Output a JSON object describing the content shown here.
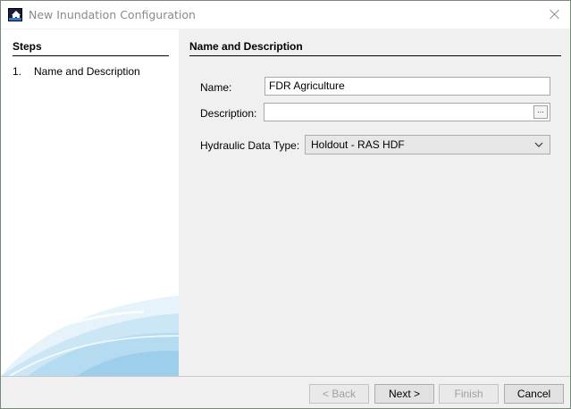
{
  "window": {
    "title": "New Inundation Configuration",
    "icon": "app-house-flood-icon",
    "close_icon": "close-icon"
  },
  "steps": {
    "heading": "Steps",
    "items": [
      {
        "number": "1.",
        "label": "Name and Description"
      }
    ]
  },
  "form": {
    "heading": "Name and Description",
    "name_label": "Name:",
    "name_value": "FDR Agriculture",
    "description_label": "Description:",
    "description_value": "",
    "browse_label": "...",
    "hydraulic_label": "Hydraulic Data Type:",
    "hydraulic_value": "Holdout - RAS HDF"
  },
  "buttons": {
    "back": "< Back",
    "next": "Next >",
    "finish": "Finish",
    "cancel": "Cancel"
  },
  "colors": {
    "swoosh_light": "#d6ebf6",
    "swoosh_mid": "#a9d3ec",
    "accent_blue": "#2a78d0"
  }
}
